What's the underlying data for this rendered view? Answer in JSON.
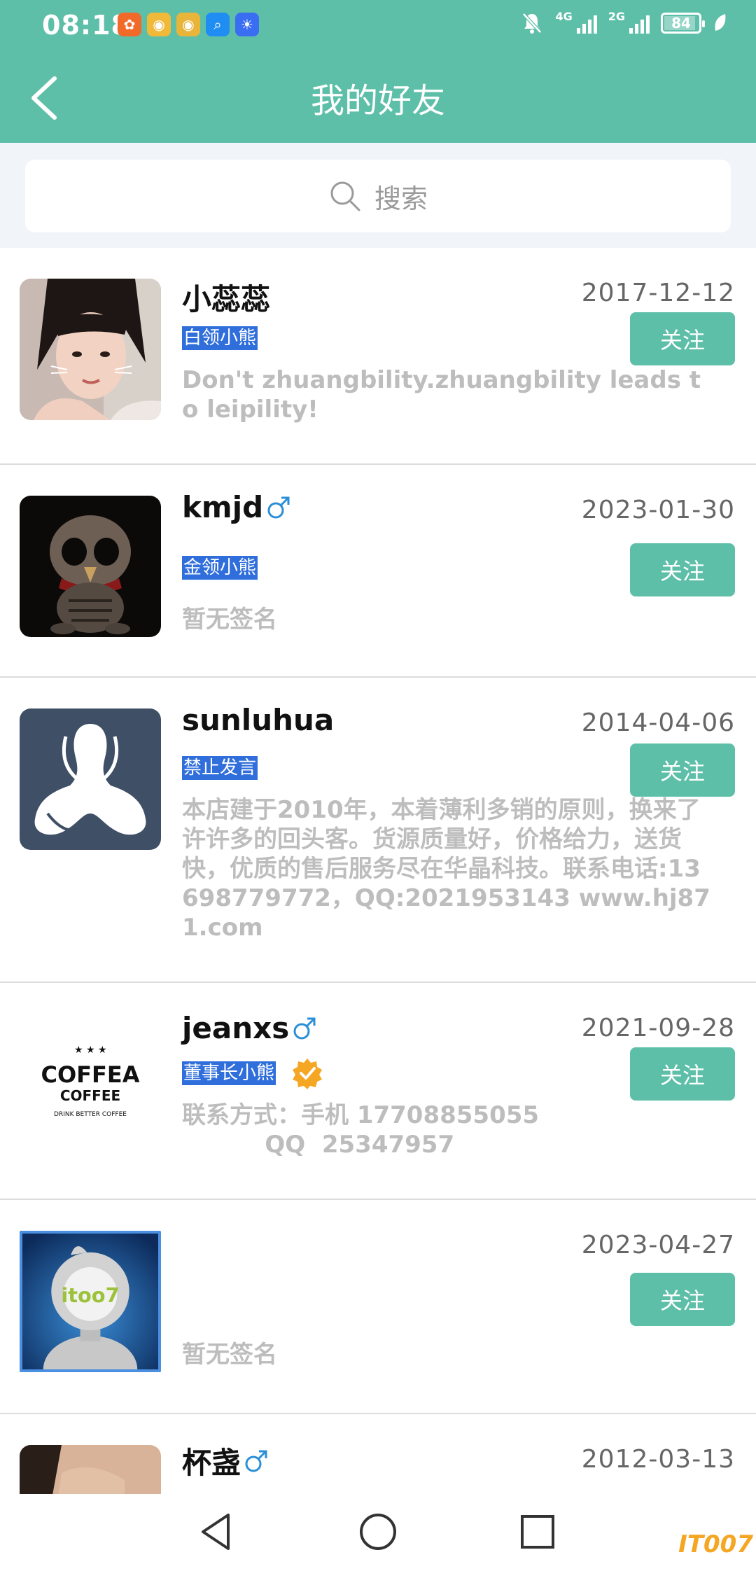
{
  "status_bar": {
    "time": "08:18",
    "network_1": "4G",
    "network_2": "2G",
    "battery": "84",
    "battery_level": 0.84
  },
  "header": {
    "title": "我的好友"
  },
  "search": {
    "placeholder": "搜索"
  },
  "friends": [
    {
      "name": "小蕊蕊",
      "gender": "",
      "level": "白领小熊",
      "verified": false,
      "date": "2017-12-12",
      "follow_label": "关注",
      "signature": "Don't zhuangbility.zhuangbility leads to leipility!"
    },
    {
      "name": "kmjd",
      "gender": "male",
      "level": "金领小熊",
      "verified": false,
      "date": "2023-01-30",
      "follow_label": "关注",
      "signature": "暂无签名"
    },
    {
      "name": "sunluhua",
      "gender": "",
      "level": "禁止发言",
      "verified": false,
      "date": "2014-04-06",
      "follow_label": "关注",
      "signature": "本店建于2010年，本着薄利多销的原则，换来了许许多的回头客。货源质量好，价格给力，送货快，优质的售后服务尽在华晶科技。联系电话:13698779772，QQ:2021953143 www.hj871.com"
    },
    {
      "name": "jeanxs",
      "gender": "male",
      "level": "董事长小熊",
      "verified": true,
      "date": "2021-09-28",
      "follow_label": "关注",
      "signature": "联系方式：手机 17708855055\n          QQ  25347957"
    },
    {
      "name": "",
      "gender": "",
      "level": "",
      "verified": false,
      "date": "2023-04-27",
      "follow_label": "关注",
      "signature": "暂无签名"
    },
    {
      "name": "杯盏",
      "gender": "male",
      "level": "",
      "verified": false,
      "date": "2012-03-13",
      "follow_label": "",
      "signature": ""
    }
  ],
  "avatars": {
    "friend_4_line1": "COFFEA",
    "friend_4_line2": "COFFEE",
    "friend_4_line3": "DRINK BETTER COFFEE",
    "friend_5_logo": "itoo7"
  },
  "watermark": "IT007",
  "colors": {
    "accent": "#5ebfa9",
    "level_tag": "#2f6edb",
    "gender": "#2a8fd6"
  }
}
